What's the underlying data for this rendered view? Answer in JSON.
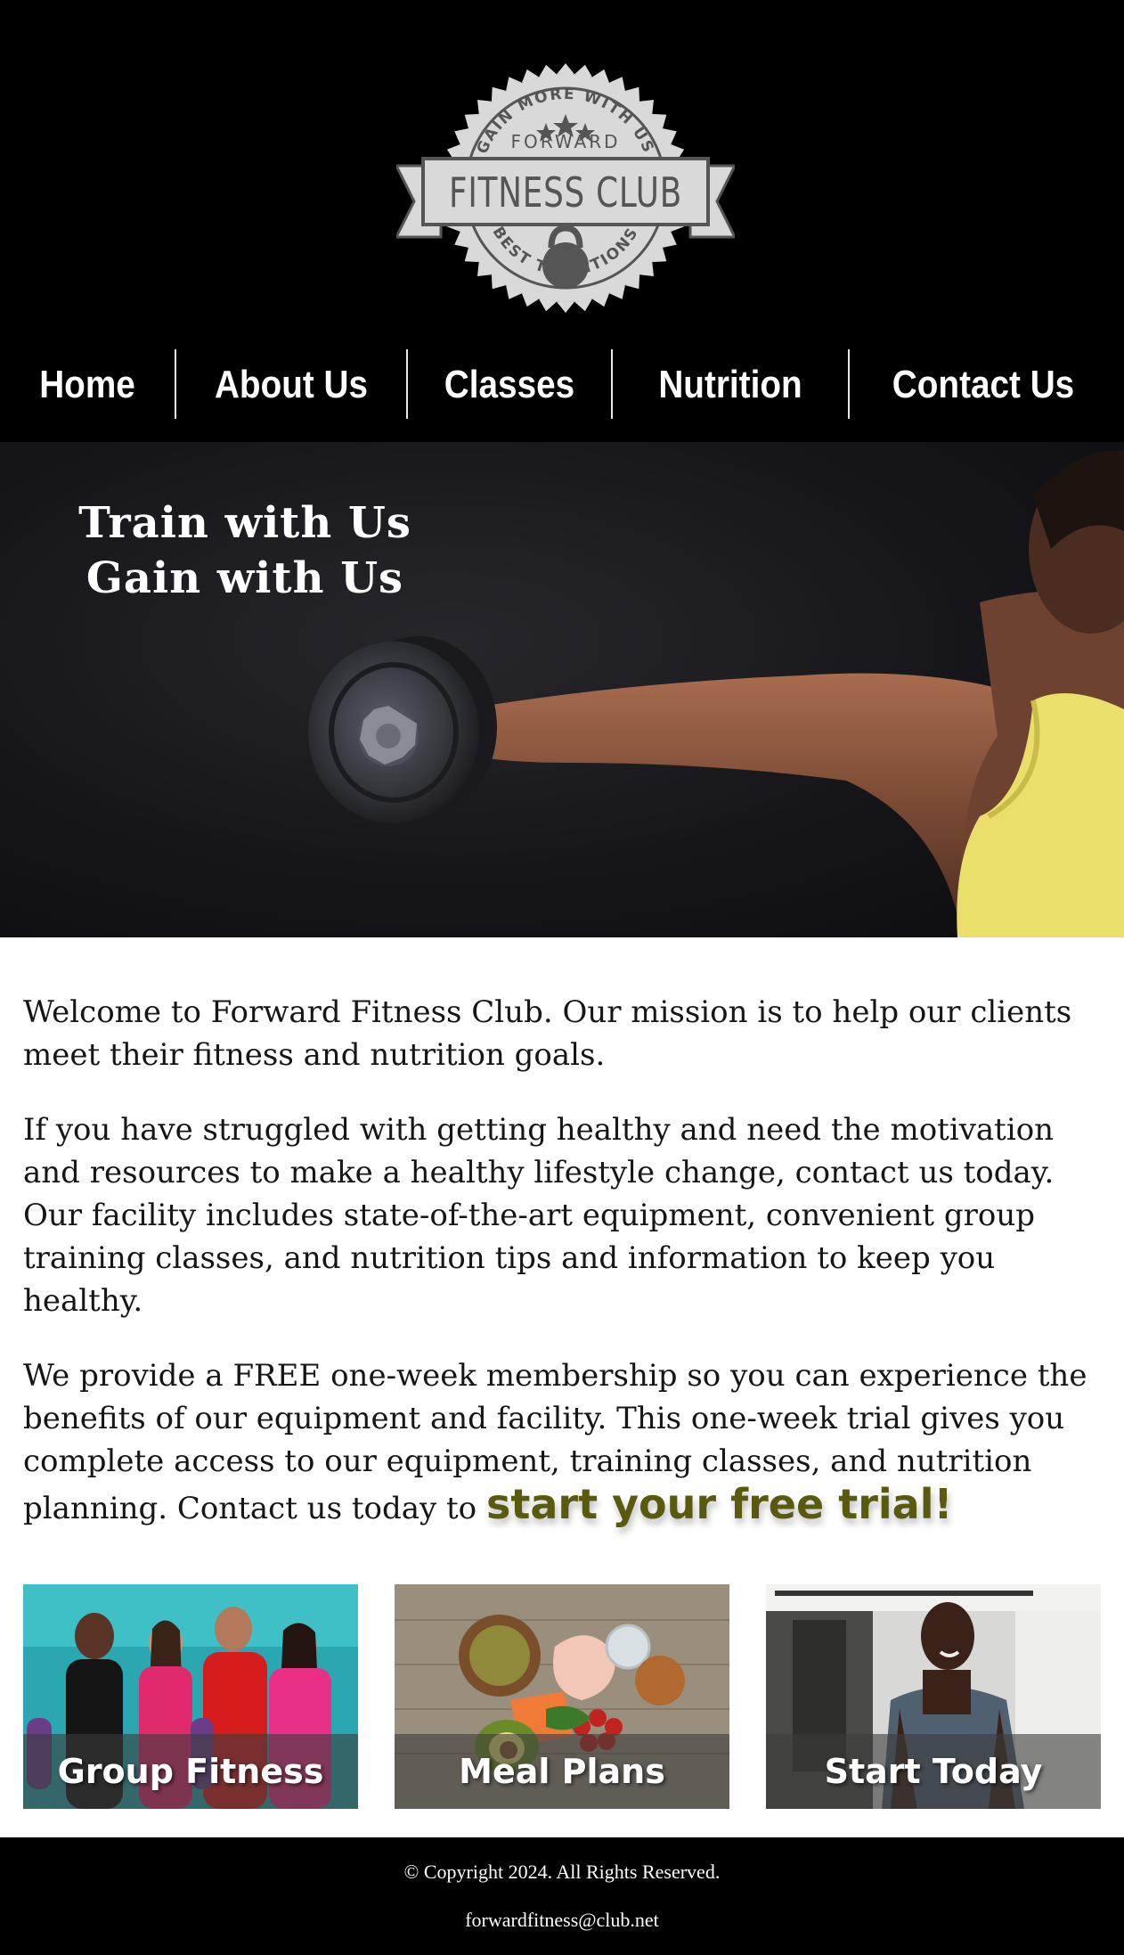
{
  "logo": {
    "arc_top": "GAIN MORE WITH US",
    "subtitle": "FORWARD",
    "name": "FITNESS CLUB",
    "arc_bottom": "BEST TRADITIONS",
    "icon": "kettlebell-icon"
  },
  "nav": {
    "items": [
      {
        "label": "Home"
      },
      {
        "label": "About Us"
      },
      {
        "label": "Classes"
      },
      {
        "label": "Nutrition"
      },
      {
        "label": "Contact Us"
      }
    ]
  },
  "hero": {
    "line1": "Train with Us",
    "line2": "Gain with Us"
  },
  "main": {
    "p1": "Welcome to Forward Fitness Club. Our mission is to help our clients meet their fitness and nutrition goals.",
    "p2": "If you have struggled with getting healthy and need the motivation and resources to make a healthy lifestyle change, contact us today. Our facility includes state-of-the-art equipment, convenient group training classes, and nutrition tips and information to keep you healthy.",
    "p3": "We provide a FREE one-week membership so you can experience the benefits of our equipment and facility. This one-week trial gives you complete access to our equipment, training classes, and nutrition planning. Contact us today to ",
    "cta": "start your free trial!"
  },
  "cards": [
    {
      "label": "Group Fitness"
    },
    {
      "label": "Meal Plans"
    },
    {
      "label": "Start Today"
    }
  ],
  "footer": {
    "copyright": "© Copyright 2024. All Rights Reserved.",
    "email": "forwardfitness@club.net"
  },
  "colors": {
    "header_bg": "#000000",
    "cta": "#5a5a0f",
    "logo_gray": "#d9d9d9"
  }
}
